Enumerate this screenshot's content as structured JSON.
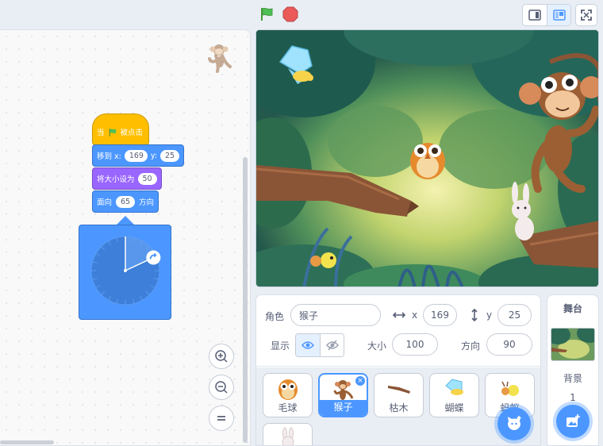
{
  "code": {
    "hat_when": "当",
    "hat_clicked": "被点击",
    "goto_label": "移到 x:",
    "goto_x": "169",
    "goto_y_label": "y:",
    "goto_y": "25",
    "size_label": "将大小设为",
    "size_value": "50",
    "dir_label": "面向",
    "dir_value": "65",
    "dir_suffix": "方向",
    "dial_value_deg": 65
  },
  "sprite_info": {
    "sprite_label": "角色",
    "sprite_name": "猴子",
    "x_label": "x",
    "x_value": "169",
    "y_label": "y",
    "y_value": "25",
    "show_label": "显示",
    "size_label": "大小",
    "size_value": "100",
    "direction_label": "方向",
    "direction_value": "90"
  },
  "sprites": [
    {
      "name": "毛球",
      "icon": "owl-icon"
    },
    {
      "name": "猴子",
      "icon": "monkey-icon",
      "selected": true
    },
    {
      "name": "枯木",
      "icon": "log-icon"
    },
    {
      "name": "蝴蝶",
      "icon": "butterfly-icon"
    },
    {
      "name": "蚂蚁",
      "icon": "ant-icon"
    },
    {
      "name": "",
      "icon": "rabbit-icon"
    }
  ],
  "stage_pane": {
    "title": "舞台",
    "backdrop_label": "背景",
    "backdrop_count": "1"
  },
  "colors": {
    "motion": "#4c97ff",
    "looks": "#9966ff",
    "events": "#ffbf00",
    "accent": "#4c97ff"
  }
}
